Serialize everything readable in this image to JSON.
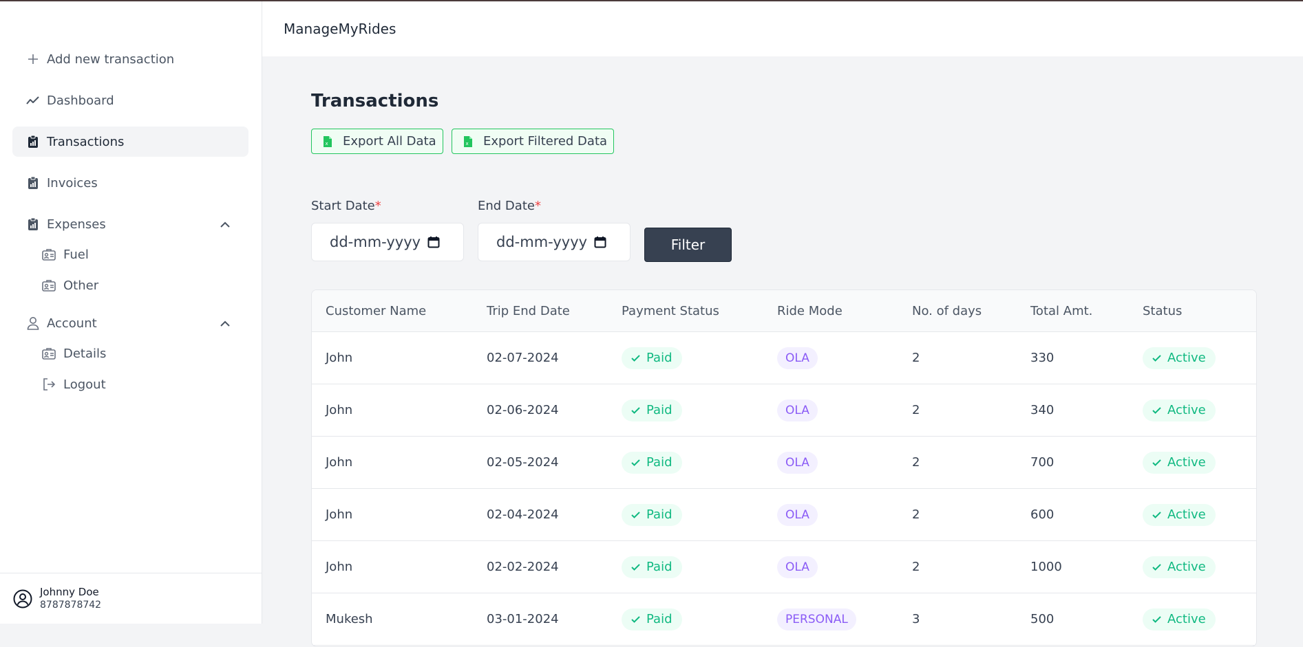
{
  "app": {
    "brand": "ManageMyRides"
  },
  "sidebar": {
    "items": [
      {
        "label": "Add new transaction",
        "icon": "plus-icon"
      },
      {
        "label": "Dashboard",
        "icon": "trend-icon"
      },
      {
        "label": "Transactions",
        "icon": "clipboard-icon",
        "active": true
      },
      {
        "label": "Invoices",
        "icon": "clipboard-icon"
      },
      {
        "label": "Expenses",
        "icon": "clipboard-icon",
        "expanded": true
      },
      {
        "label": "Account",
        "icon": "user-icon",
        "expanded": true
      }
    ],
    "expenses_sub": [
      {
        "label": "Fuel",
        "icon": "id-card-icon"
      },
      {
        "label": "Other",
        "icon": "id-card-icon"
      }
    ],
    "account_sub": [
      {
        "label": "Details",
        "icon": "id-card-icon"
      },
      {
        "label": "Logout",
        "icon": "logout-icon"
      }
    ],
    "profile": {
      "name": "Johnny Doe",
      "phone": "8787878742"
    }
  },
  "main": {
    "title": "Transactions",
    "export_all": "Export All Data",
    "export_filtered": "Export Filtered Data",
    "start_date_label": "Start Date",
    "end_date_label": "End Date",
    "required_mark": "*",
    "date_placeholder": "dd-mm-yyyy",
    "filter_label": "Filter",
    "table": {
      "columns": [
        "Customer Name",
        "Trip End Date",
        "Payment Status",
        "Ride Mode",
        "No. of days",
        "Total Amt.",
        "Status"
      ],
      "rows": [
        {
          "customer": "John",
          "trip_end": "02-07-2024",
          "payment": "Paid",
          "mode": "OLA",
          "days": "2",
          "amount": "330",
          "status": "Active"
        },
        {
          "customer": "John",
          "trip_end": "02-06-2024",
          "payment": "Paid",
          "mode": "OLA",
          "days": "2",
          "amount": "340",
          "status": "Active"
        },
        {
          "customer": "John",
          "trip_end": "02-05-2024",
          "payment": "Paid",
          "mode": "OLA",
          "days": "2",
          "amount": "700",
          "status": "Active"
        },
        {
          "customer": "John",
          "trip_end": "02-04-2024",
          "payment": "Paid",
          "mode": "OLA",
          "days": "2",
          "amount": "600",
          "status": "Active"
        },
        {
          "customer": "John",
          "trip_end": "02-02-2024",
          "payment": "Paid",
          "mode": "OLA",
          "days": "2",
          "amount": "1000",
          "status": "Active"
        },
        {
          "customer": "Mukesh",
          "trip_end": "03-01-2024",
          "payment": "Paid",
          "mode": "PERSONAL",
          "days": "3",
          "amount": "500",
          "status": "Active"
        }
      ]
    }
  },
  "colors": {
    "accent_green": "#10b981",
    "accent_purple": "#8b5cf6",
    "filter_bg": "#374151",
    "required": "#ef4444"
  }
}
